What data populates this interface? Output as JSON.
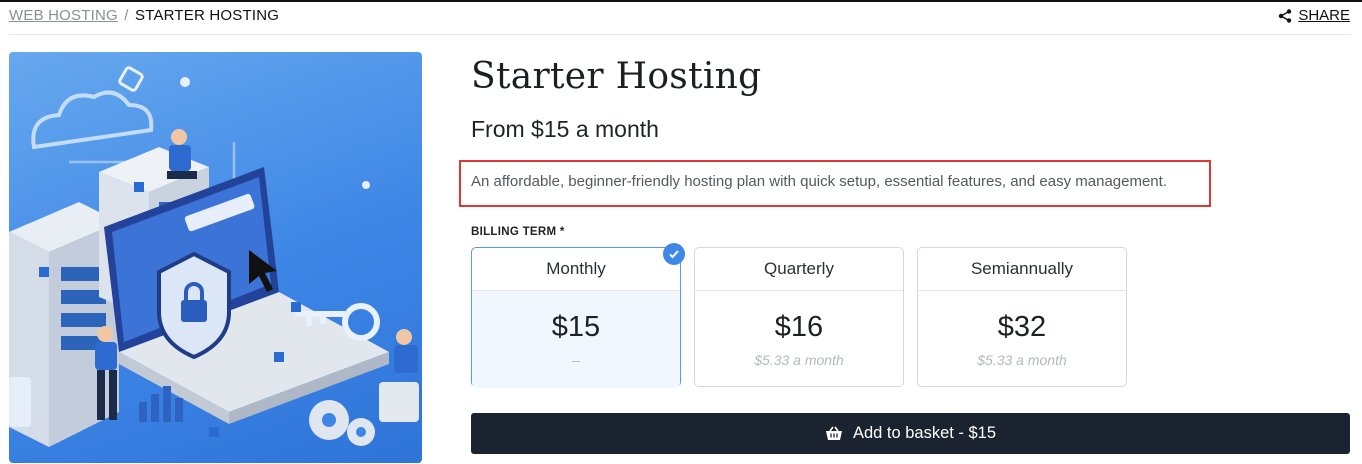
{
  "breadcrumb": {
    "parent": "WEB HOSTING",
    "separator": "/",
    "current": "STARTER HOSTING"
  },
  "share": {
    "label": "SHARE",
    "icon": "share-icon"
  },
  "product": {
    "title": "Starter Hosting",
    "subtitle": "From $15 a month",
    "description": "An affordable, beginner-friendly hosting plan with quick setup, essential features, and easy management.",
    "image_icon": "hosting-illustration"
  },
  "billing": {
    "label": "BILLING TERM *",
    "selected": "Monthly",
    "options": [
      {
        "name": "Monthly",
        "price": "$15",
        "per": "–"
      },
      {
        "name": "Quarterly",
        "price": "$16",
        "per": "$5.33 a month"
      },
      {
        "name": "Semiannually",
        "price": "$32",
        "per": "$5.33 a month"
      }
    ]
  },
  "cta": {
    "label": "Add to basket - $15",
    "icon": "basket-icon"
  },
  "colors": {
    "accent": "#3f88e8",
    "highlight_border": "#d93a36",
    "button_bg": "#1c2330"
  }
}
